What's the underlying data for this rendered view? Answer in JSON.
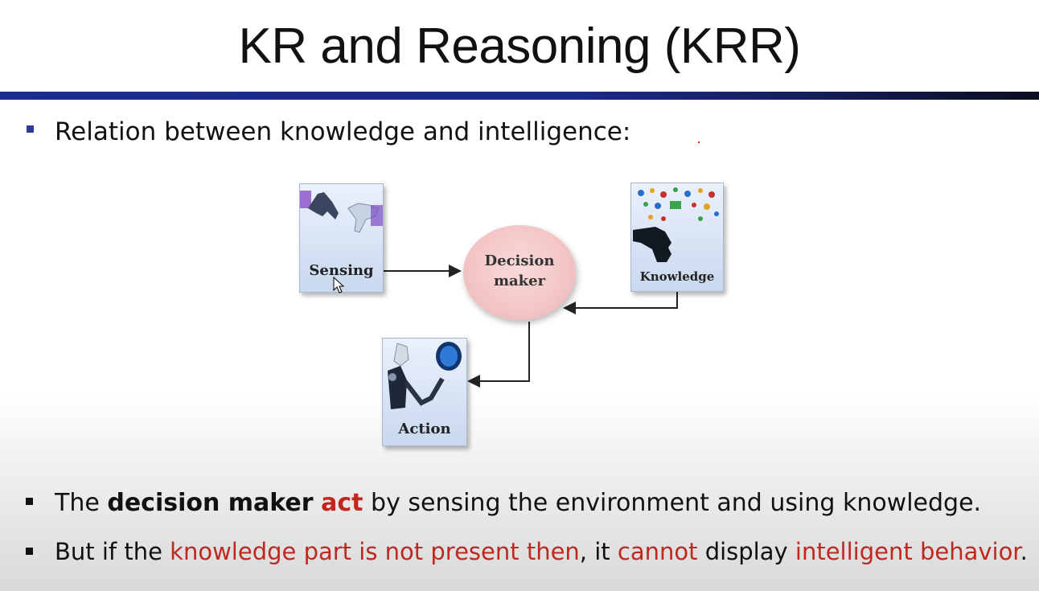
{
  "slide": {
    "title": "KR and Reasoning (KRR)",
    "intro_bullet": "Relation between knowledge and intelligence:",
    "diagram": {
      "sensing_label": "Sensing",
      "decision_line1": "Decision",
      "decision_line2": "maker",
      "knowledge_label": "Knowledge",
      "action_label": "Action"
    },
    "bullet1": {
      "part1": "The ",
      "bold1": "decision maker",
      "space": " ",
      "red_bold": "act",
      "part2": " by sensing the environment and using knowledge."
    },
    "bullet2": {
      "part1": "But if the ",
      "red1": "knowledge part is not present then",
      "part2": ", it ",
      "red2": "cannot",
      "part3": " display ",
      "red3": "intelligent behavior",
      "part4": "."
    }
  },
  "colors": {
    "title_rule": "#1e2b8f",
    "emphasis_red": "#c0281f",
    "bullet_blue": "#2e3a9a"
  }
}
